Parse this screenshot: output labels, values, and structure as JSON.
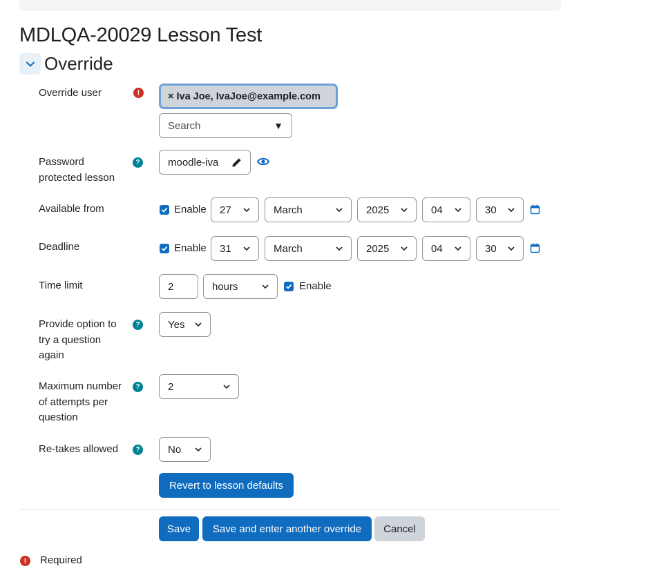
{
  "page": {
    "title": "MDLQA-20029 Lesson Test",
    "section_title": "Override"
  },
  "form": {
    "override_user": {
      "label": "Override user",
      "selected_tag": "× Iva Joe, IvaJoe@example.com",
      "search_placeholder": "Search",
      "search_arrow": "▼"
    },
    "password": {
      "label": "Password protected lesson",
      "value": "moodle-iva"
    },
    "available_from": {
      "label": "Available from",
      "enable_label": "Enable",
      "enabled": true,
      "day": "27",
      "month": "March",
      "year": "2025",
      "hour": "04",
      "minute": "30"
    },
    "deadline": {
      "label": "Deadline",
      "enable_label": "Enable",
      "enabled": true,
      "day": "31",
      "month": "March",
      "year": "2025",
      "hour": "04",
      "minute": "30"
    },
    "time_limit": {
      "label": "Time limit",
      "value": "2",
      "unit": "hours",
      "enable_label": "Enable",
      "enabled": true
    },
    "try_again": {
      "label": "Provide option to try a question again",
      "value": "Yes"
    },
    "max_attempts": {
      "label": "Maximum number of attempts per question",
      "value": "2"
    },
    "retakes": {
      "label": "Re-takes allowed",
      "value": "No"
    },
    "revert_button": "Revert to lesson defaults"
  },
  "actions": {
    "save": "Save",
    "save_another": "Save and enter another override",
    "cancel": "Cancel"
  },
  "footer": {
    "required_label": "Required"
  },
  "colors": {
    "primary": "#0f6cbf",
    "help": "#008196",
    "required": "#ca3120",
    "secondary": "#ced4da"
  }
}
